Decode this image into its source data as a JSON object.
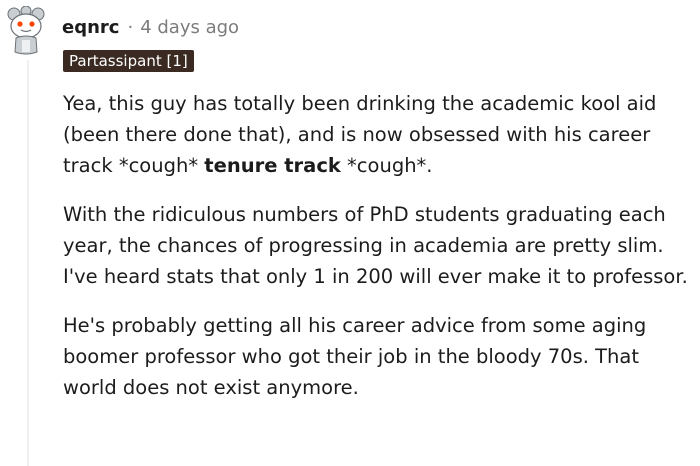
{
  "comment": {
    "username": "eqnrc",
    "separator": "·",
    "timestamp": "4 days ago",
    "flair": "Partassipant [1]",
    "paragraphs": [
      {
        "pre": "Yea, this guy has totally been drinking the academic kool aid (been there done that), and is now obsessed with his career track *cough* ",
        "bold": "tenure track",
        "post": " *cough*."
      },
      {
        "text": "With the ridiculous numbers of PhD students graduating each year, the chances of progressing in academia are pretty slim. I've heard stats that only 1 in 200 will ever make it to professor."
      },
      {
        "text": "He's probably getting all his career advice from some aging boomer professor who got their job in the bloody 70s. That world does not exist anymore."
      }
    ]
  },
  "colors": {
    "flair_bg": "#3a2a22",
    "meta_gray": "#7c7c7c",
    "text": "#1c1c1c",
    "thread_line": "#edeff1",
    "avatar_face": "#ffffff",
    "avatar_ears": "#c9ced2",
    "avatar_nose": "#ff4500"
  },
  "icons": {
    "avatar": "snoo-avatar-icon"
  }
}
